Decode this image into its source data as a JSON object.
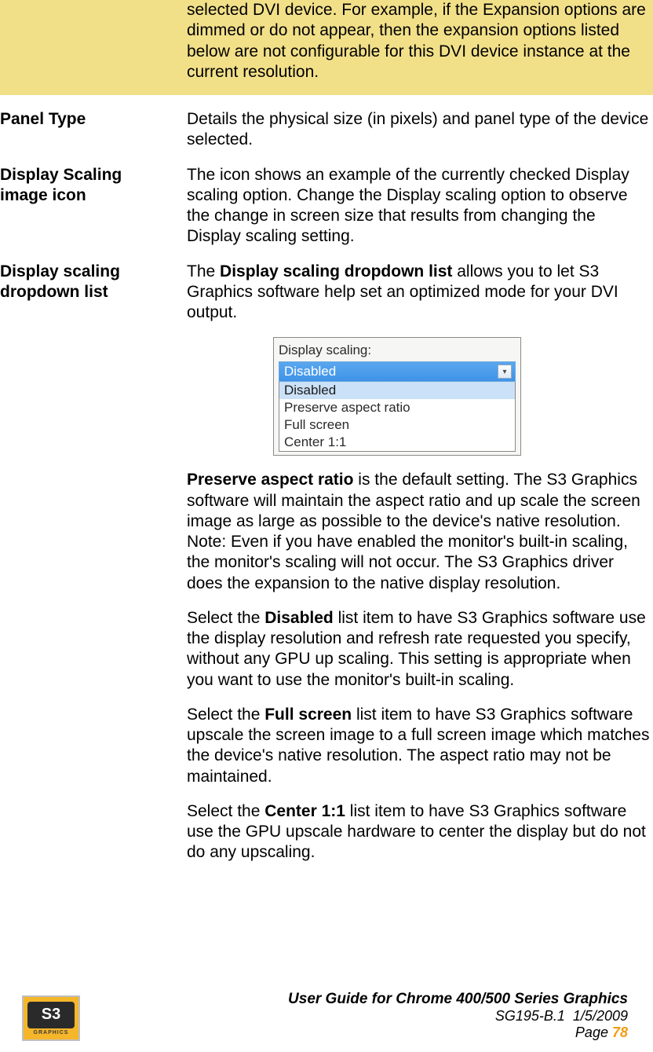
{
  "highlight": {
    "desc": "selected DVI device. For example, if the Expansion options are dimmed or do not appear, then the expansion options listed below are not configurable for this DVI device instance at the current resolution."
  },
  "panel_type": {
    "label": "Panel Type",
    "desc": "Details the physical size (in pixels) and panel type of the device selected."
  },
  "scaling_icon": {
    "label_line1": "Display Scaling",
    "label_line2": "image icon",
    "desc": "The icon shows an example of the currently checked Display scaling option. Change the Display scaling option to observe the change in screen size that results from changing the Display scaling setting."
  },
  "scaling_dropdown": {
    "label_line1": "Display scaling",
    "label_line2": "dropdown list",
    "intro_part1": "The ",
    "intro_bold": "Display scaling dropdown list",
    "intro_part2": " allows you to let S3 Graphics software help set an optimized mode for your DVI output.",
    "figure": {
      "label": "Display scaling:",
      "selected": "Disabled",
      "options": [
        "Disabled",
        "Preserve aspect ratio",
        "Full screen",
        "Center 1:1"
      ]
    },
    "preserve_bold": "Preserve aspect ratio",
    "preserve_text": " is the default setting. The S3 Graphics software will maintain the aspect ratio and up scale the screen image as large as possible to the device's native resolution.",
    "preserve_note": "Note: Even if you have enabled the monitor's built-in scaling, the monitor's scaling will not occur. The S3 Graphics driver does the expansion to the native display resolution.",
    "disabled_pre": "Select the ",
    "disabled_bold": "Disabled",
    "disabled_post": " list item to have S3 Graphics software use the display resolution and refresh rate requested you specify, without any GPU up scaling. This setting is appropriate when you want to use the monitor's built-in scaling.",
    "full_pre": "Select the ",
    "full_bold": "Full screen",
    "full_post": " list item to have S3 Graphics software upscale the screen image to a full screen image which matches the device's native resolution. The aspect ratio may not be maintained.",
    "center_pre": "Select the ",
    "center_bold": "Center 1:1",
    "center_post": " list item to have S3 Graphics software use the GPU upscale hardware to center the display but do not do any upscaling."
  },
  "footer": {
    "logo_text": "S3",
    "logo_tag": "GRAPHICS",
    "line1": "User Guide for Chrome 400/500 Series Graphics",
    "doc_id": "SG195-B.1",
    "date": "1/5/2009",
    "page_label": "Page ",
    "page_num": "78"
  }
}
